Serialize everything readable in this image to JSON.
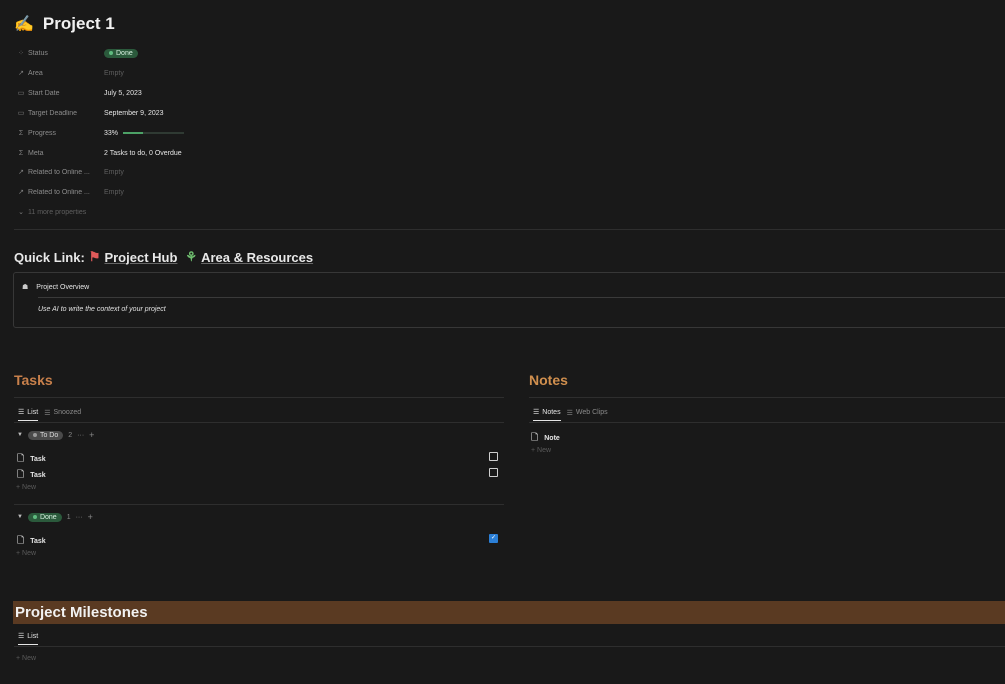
{
  "page": {
    "icon": "writing-hand-icon",
    "title": "Project 1"
  },
  "properties": [
    {
      "icon": "spinner-icon",
      "label": "Status",
      "value": "Done",
      "type": "status"
    },
    {
      "icon": "arrow-ne-icon",
      "label": "Area",
      "value": "Empty",
      "type": "empty"
    },
    {
      "icon": "calendar-icon",
      "label": "Start Date",
      "value": "July 5, 2023",
      "type": "text"
    },
    {
      "icon": "calendar-icon",
      "label": "Target Deadline",
      "value": "September 9, 2023",
      "type": "text"
    },
    {
      "icon": "sigma-icon",
      "label": "Progress",
      "value": "33%",
      "type": "progress",
      "progress": 0.33
    },
    {
      "icon": "sigma-icon",
      "label": "Meta",
      "value": "2 Tasks to do, 0 Overdue",
      "type": "text"
    },
    {
      "icon": "arrow-ne-icon",
      "label": "Related to Online ...",
      "value": "Empty",
      "type": "empty"
    },
    {
      "icon": "arrow-ne-icon",
      "label": "Related to Online ...",
      "value": "Empty",
      "type": "empty"
    }
  ],
  "more_properties": "11 more properties",
  "quick_links": {
    "label": "Quick Link:",
    "links": [
      {
        "icon": "project-hub-icon",
        "label": "Project Hub"
      },
      {
        "icon": "area-resources-icon",
        "label": "Area & Resources"
      }
    ]
  },
  "callout": {
    "icon": "robot-icon",
    "title": "Project Overview",
    "body": "Use AI to write the context of your project"
  },
  "tasks": {
    "heading": "Tasks",
    "tabs": [
      {
        "label": "List",
        "active": true
      },
      {
        "label": "Snoozed",
        "active": false
      }
    ],
    "groups": [
      {
        "status": "To Do",
        "count": "2",
        "items": [
          {
            "title": "Task",
            "checked": false
          },
          {
            "title": "Task",
            "checked": false
          }
        ]
      },
      {
        "status": "Done",
        "count": "1",
        "items": [
          {
            "title": "Task",
            "checked": true
          }
        ]
      }
    ],
    "new_label": "New"
  },
  "notes": {
    "heading": "Notes",
    "tabs": [
      {
        "label": "Notes",
        "active": true
      },
      {
        "label": "Web Clips",
        "active": false
      }
    ],
    "items": [
      {
        "title": "Note"
      }
    ],
    "new_label": "New"
  },
  "milestones": {
    "heading": "Project Milestones",
    "tabs": [
      {
        "label": "List",
        "active": true
      }
    ],
    "new_label": "New"
  },
  "colors": {
    "background": "#191919",
    "tasks_heading": "#c8804b",
    "notes_heading": "#d08f4e",
    "milestones_band": "#5a3a22",
    "done_badge": "#2b5a3c",
    "checkbox_on": "#2b7fd6"
  }
}
